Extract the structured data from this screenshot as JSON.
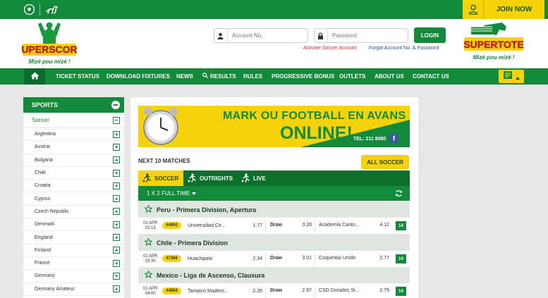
{
  "topbar": {
    "icons": [
      "soccer-ball-icon",
      "horse-racing-icon"
    ],
    "join_label": "JOIN NOW"
  },
  "header": {
    "logo_text": "SUPERSCORE",
    "logo_tagline": "Mizé pou mizé !",
    "account_placeholder": "Account No.",
    "password_placeholder": "Password",
    "login_label": "LOGIN",
    "activate_link": "Activate Soccer Account",
    "forgot_link": "Forgot Account No. & Password",
    "partner_logo_text": "SUPERTOTE",
    "partner_tagline": "Mizé pou mizé !"
  },
  "nav": {
    "items": [
      "TICKET STATUS",
      "DOWNLOAD FIXTURES",
      "NEWS",
      "RESULTS",
      "RULES",
      "PROGRESSIVE BONUS",
      "OUTLETS",
      "ABOUT US",
      "CONTACT US"
    ]
  },
  "sidebar": {
    "title": "SPORTS",
    "sport": "Soccer",
    "countries": [
      "Argentina",
      "Austria",
      "Bulgaria",
      "Chile",
      "Croatia",
      "Cyprus",
      "Czech Republic",
      "Denmark",
      "England",
      "Finland",
      "France",
      "Germany",
      "Germany Amateur"
    ]
  },
  "main": {
    "banner_line1": "MARK OU FOOTBALL EN AVANS",
    "banner_line2": "ONLINE!",
    "banner_tel": "TEL: 211 8080",
    "next_title": "NEXT 10 MATCHES",
    "all_soccer": "ALL SOCCER",
    "tabs": [
      "SOCCER",
      "OUTRIGHTS",
      "LIVE"
    ],
    "market": "1 X 2 FULL TIME",
    "leagues": [
      {
        "name": "Peru - Primera Division, Apertura",
        "match": {
          "date": "01 APR",
          "time": "03:15",
          "code": "44900",
          "home": "Universidad Ce...",
          "home_odds": "1.77",
          "draw": "Draw",
          "draw_odds": "3.20",
          "away": "Academia Canto...",
          "away_odds": "4.12",
          "more": "14"
        }
      },
      {
        "name": "Chile - Primera Division",
        "match": {
          "date": "01 APR",
          "time": "03:30",
          "code": "47366",
          "home": "Huachipato",
          "home_odds": "2.34",
          "draw": "Draw",
          "draw_odds": "3.01",
          "away": "Coquimbo Unido",
          "away_odds": "2.77",
          "more": "14"
        }
      },
      {
        "name": "Mexico - Liga de Ascenso, Clausura",
        "match": {
          "date": "01 APR",
          "time": "04:00",
          "code": "44858",
          "home": "Tampico Madero...",
          "home_odds": "2.35",
          "draw": "Draw",
          "draw_odds": "2.97",
          "away": "CSD Dorados Si...",
          "away_odds": "2.79",
          "more": "14"
        }
      }
    ]
  },
  "colors": {
    "brand_green": "#138a3a",
    "accent_yellow": "#f5d20a",
    "dark_green": "#0e6e2c"
  }
}
